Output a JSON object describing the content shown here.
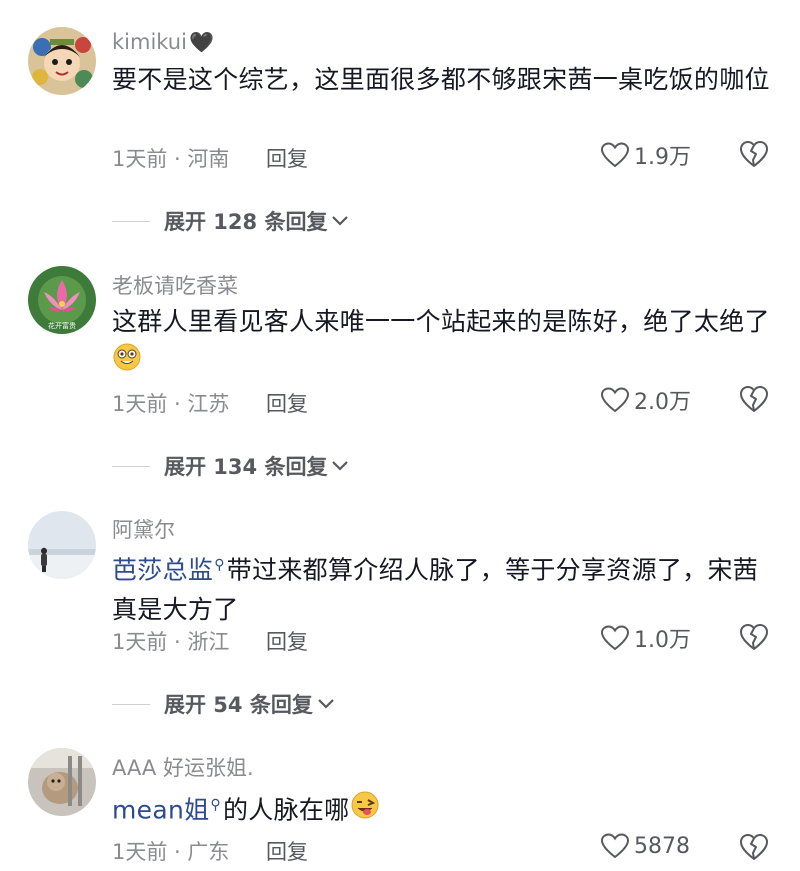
{
  "comments": [
    {
      "username": "kimikui",
      "username_suffix": "🖤",
      "text": "要不是这个综艺，这里面很多都不够跟宋茜一桌吃饭的咖位",
      "meta": "1天前 · 河南",
      "reply_label": "回复",
      "likes": "1.9万",
      "expand_label": "展开 128 条回复"
    },
    {
      "username": "老板请吃香菜",
      "text": "这群人里看见客人来唯一一个站起来的是陈好，绝了太绝了",
      "meta": "1天前 · 江苏",
      "reply_label": "回复",
      "likes": "2.0万",
      "expand_label": "展开 134 条回复"
    },
    {
      "username": "阿黛尔",
      "mention": "芭莎总监",
      "text": "带过来都算介绍人脉了，等于分享资源了，宋茜真是大方了",
      "meta": "1天前 · 浙江",
      "reply_label": "回复",
      "likes": "1.0万",
      "expand_label": "展开 54 条回复"
    },
    {
      "username": "AAA 好运张姐.",
      "mention": "mean姐",
      "text": "的人脉在哪",
      "meta": "1天前 · 广东",
      "reply_label": "回复",
      "likes": "5878"
    }
  ],
  "avatar2_caption": "花开富贵",
  "mention_icon": "search-icon",
  "colors": {
    "primary_text": "#161823",
    "secondary_text": "#8a8b91",
    "mention": "#2d4b8d",
    "action_text": "#57595f"
  }
}
